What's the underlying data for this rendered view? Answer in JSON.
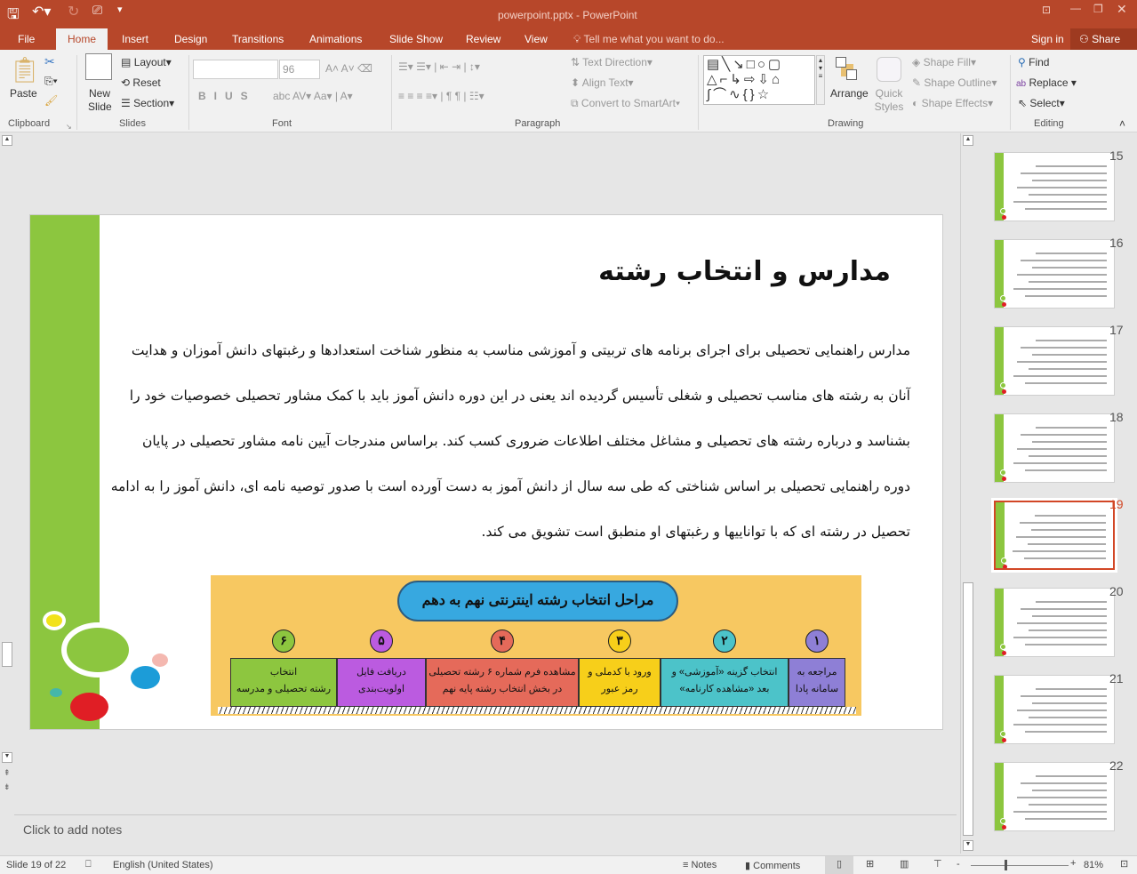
{
  "window": {
    "title": "powerpoint.pptx - PowerPoint"
  },
  "tabs": [
    "File",
    "Home",
    "Insert",
    "Design",
    "Transitions",
    "Animations",
    "Slide Show",
    "Review",
    "View"
  ],
  "tell_me": "Tell me what you want to do...",
  "sign_in": "Sign in",
  "share": "Share",
  "ribbon": {
    "clipboard": {
      "label": "Clipboard",
      "paste": "Paste"
    },
    "slides": {
      "label": "Slides",
      "new_slide": "New Slide",
      "layout": "Layout",
      "reset": "Reset",
      "section": "Section"
    },
    "font": {
      "label": "Font",
      "font_name": "",
      "font_size": "96"
    },
    "paragraph": {
      "label": "Paragraph",
      "text_direction": "Text Direction",
      "align_text": "Align Text",
      "convert_smartart": "Convert to SmartArt"
    },
    "drawing": {
      "label": "Drawing",
      "arrange": "Arrange",
      "quick_styles": "Quick Styles",
      "shape_fill": "Shape Fill",
      "shape_outline": "Shape Outline",
      "shape_effects": "Shape Effects"
    },
    "editing": {
      "label": "Editing",
      "find": "Find",
      "replace": "Replace",
      "select": "Select"
    }
  },
  "slide": {
    "title": "مدارس و انتخاب رشته",
    "paragraphs": [
      "مدارس راهنمایی تحصیلی برای اجرای برنامه های تربیتی و آموزشی مناسب به منظور شناخت استعدادها و رغبتهای دانش آموزان و هدایت",
      "آنان به رشته های مناسب تحصیلی و شغلی تأسیس گردیده اند یعنی در این دوره دانش آموز باید با کمک مشاور تحصیلی خصوصیات خود را",
      "بشناسد و درباره رشته های تحصیلی و مشاغل مختلف اطلاعات ضروری کسب کند. براساس مندرجات آیین نامه مشاور تحصیلی در پایان",
      "دوره راهنمایی تحصیلی بر اساس شناختی که طی سه سال از دانش آموز به دست آورده است با صدور توصیه نامه ای، دانش آموز را به ادامه",
      "تحصیل در رشته ای که با تواناییها و رغبتهای او منطبق است تشویق می کند."
    ],
    "infographic": {
      "title": "مراحل انتخاب رشته اینترنتی نهم به دهم",
      "steps": [
        {
          "num": "۱",
          "line1": "مراجعه به",
          "line2": "سامانه پادا",
          "color": "#8E7FD6"
        },
        {
          "num": "۲",
          "line1": "انتخاب گزینه «آموزشی» و",
          "line2": "بعد «مشاهده کارنامه»",
          "color": "#4CC3C9"
        },
        {
          "num": "۳",
          "line1": "ورود با کدملی و",
          "line2": "رمز عبور",
          "color": "#F7CF1A"
        },
        {
          "num": "۴",
          "line1": "مشاهده فرم شماره ۶ رشته تحصیلی",
          "line2": "در بخش انتخاب رشته پایه نهم",
          "color": "#E56A5A"
        },
        {
          "num": "۵",
          "line1": "دریافت فایل",
          "line2": "اولویت‌بندی",
          "color": "#BB5BE0"
        },
        {
          "num": "۶",
          "line1": "انتخاب",
          "line2": "رشته تحصیلی و مدرسه",
          "color": "#8DC63F"
        }
      ]
    }
  },
  "thumbnails": [
    {
      "num": "15"
    },
    {
      "num": "16"
    },
    {
      "num": "17"
    },
    {
      "num": "18"
    },
    {
      "num": "19",
      "selected": true
    },
    {
      "num": "20"
    },
    {
      "num": "21"
    },
    {
      "num": "22"
    }
  ],
  "notes_placeholder": "Click to add notes",
  "status": {
    "slide": "Slide 19 of 22",
    "language": "English (United States)",
    "notes": "Notes",
    "comments": "Comments",
    "zoom": "81%"
  },
  "colors": {
    "accent": "#B7472A",
    "green": "#8CC63F",
    "selected_thumb": "#D24726"
  }
}
